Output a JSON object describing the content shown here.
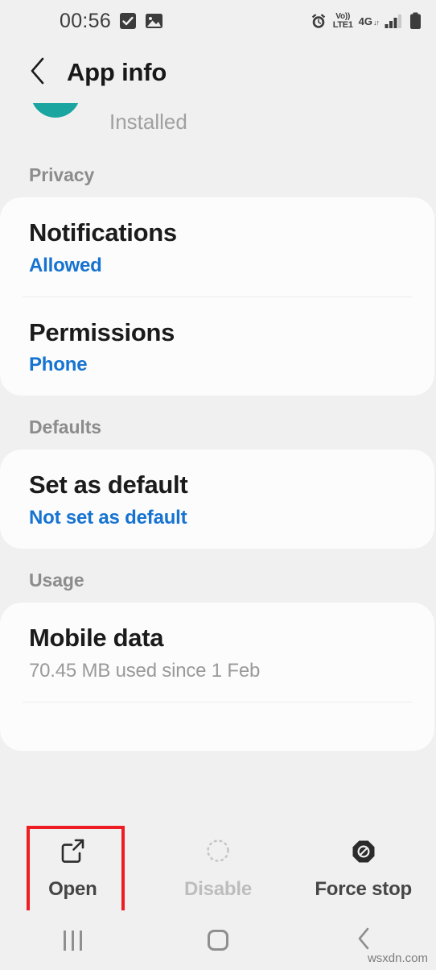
{
  "status_bar": {
    "time": "00:56",
    "left_icons": [
      "checkbox-icon",
      "image-icon"
    ],
    "network": {
      "volte_top": "Vo))",
      "volte_bottom": "LTE1",
      "generation": "4G",
      "data_arrows": "↓↑"
    },
    "right_icons": [
      "alarm-icon",
      "signal-bars-icon",
      "battery-icon"
    ]
  },
  "app_bar": {
    "back_icon": "chevron-left-icon",
    "title": "App info"
  },
  "app_header": {
    "status_text": "Installed",
    "icon_color": "#1aa5a0"
  },
  "sections": [
    {
      "label": "Privacy",
      "rows": [
        {
          "title": "Notifications",
          "subtitle": "Allowed",
          "subtitle_style": "blue"
        },
        {
          "title": "Permissions",
          "subtitle": "Phone",
          "subtitle_style": "blue"
        }
      ]
    },
    {
      "label": "Defaults",
      "rows": [
        {
          "title": "Set as default",
          "subtitle": "Not set as default",
          "subtitle_style": "blue"
        }
      ]
    },
    {
      "label": "Usage",
      "rows": [
        {
          "title": "Mobile data",
          "subtitle": "70.45 MB used since 1 Feb",
          "subtitle_style": "gray"
        }
      ]
    }
  ],
  "action_bar": [
    {
      "label": "Open",
      "icon": "open-external-icon",
      "enabled": true,
      "highlighted": true
    },
    {
      "label": "Disable",
      "icon": "dashed-circle-icon",
      "enabled": false,
      "highlighted": false
    },
    {
      "label": "Force stop",
      "icon": "stop-octagon-icon",
      "enabled": true,
      "highlighted": false
    }
  ],
  "nav_bar": {
    "recents_icon": "recents-icon",
    "home_icon": "home-icon",
    "back_icon": "back-chevron-icon"
  },
  "watermark": "wsxdn.com",
  "colors": {
    "background": "#f0f0f0",
    "card": "#fcfcfc",
    "accent_blue": "#1673d1",
    "highlight_red": "#ee1d23"
  }
}
